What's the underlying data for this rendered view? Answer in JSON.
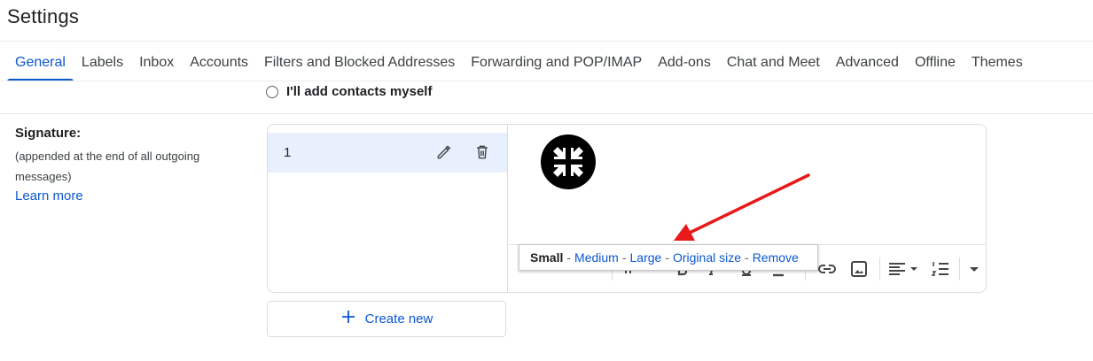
{
  "page": {
    "title": "Settings"
  },
  "tabs": [
    {
      "label": "General",
      "active": true
    },
    {
      "label": "Labels"
    },
    {
      "label": "Inbox"
    },
    {
      "label": "Accounts"
    },
    {
      "label": "Filters and Blocked Addresses"
    },
    {
      "label": "Forwarding and POP/IMAP"
    },
    {
      "label": "Add-ons"
    },
    {
      "label": "Chat and Meet"
    },
    {
      "label": "Advanced"
    },
    {
      "label": "Offline"
    },
    {
      "label": "Themes"
    }
  ],
  "contacts": {
    "option_label": "I'll add contacts myself",
    "selected": false
  },
  "signature": {
    "title": "Signature:",
    "description": "(appended at the end of all outgoing messages)",
    "learn_more": "Learn more",
    "list": [
      {
        "name": "1",
        "selected": true
      }
    ],
    "editor": {
      "logo_icon": "compress-arrows-icon",
      "toolbar_icons": [
        "font-family-dropdown",
        "font-size-icon",
        "bold-icon",
        "italic-icon",
        "underline-icon",
        "text-color-icon",
        "link-icon",
        "insert-image-icon",
        "align-dropdown-icon",
        "numbered-list-icon",
        "more-formatting-icon"
      ]
    },
    "image_size_options": {
      "current": "Small",
      "options": [
        "Medium",
        "Large",
        "Original size",
        "Remove"
      ],
      "separator": "-"
    },
    "create_new_label": "Create new"
  },
  "colors": {
    "accent": "#0b57d0",
    "selected_item_bg": "#e8f0fe",
    "annotation_arrow": "#e8191a"
  }
}
